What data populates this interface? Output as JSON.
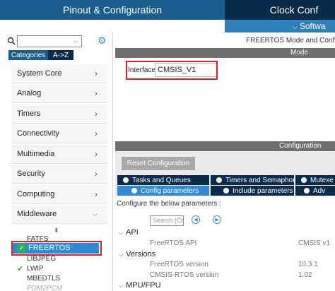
{
  "header": {
    "pinout_tab": "Pinout & Configuration",
    "clock_tab": "Clock Conf",
    "software_label": "Softwa"
  },
  "left": {
    "search_value": "",
    "categories_label": "Categories",
    "az_label": "A->Z",
    "categories": [
      "System Core",
      "Analog",
      "Timers",
      "Connectivity",
      "Multimedia",
      "Security",
      "Computing",
      "Middleware"
    ],
    "middleware_items": [
      "FATFS",
      "FREERTOS",
      "LIBJPEG",
      "LWIP",
      "MBEDTLS",
      "PDM2PCM"
    ]
  },
  "right": {
    "mode_title": "FREERTOS Mode and Configur",
    "mode_bar": "Mode",
    "interface_label": "Interface",
    "interface_value": "CMSIS_V1",
    "config_bar": "Configuration",
    "reset_button": "Reset Configuration",
    "tabs_row1": [
      "Tasks and Queues",
      "Timers and Semaphores",
      "Mutexe"
    ],
    "tabs_row2": [
      "Config parameters",
      "Include parameters",
      "Adv"
    ],
    "params_caption": "Configure the below parameters :",
    "search_placeholder": "Search (Ctrl+F)",
    "sections": {
      "api": "API",
      "versions": "Versions",
      "mpu": "MPU/FPU"
    },
    "params": [
      {
        "name": "FreeRTOS API",
        "value": "CMSIS v1"
      },
      {
        "name": "FreeRTOS version",
        "value": "10.3.1"
      },
      {
        "name": "CMSIS-RTOS version",
        "value": "1.02"
      }
    ]
  },
  "colors": {
    "header_blue": "#1b5d8e",
    "header_dark": "#0a2b4a",
    "accent_blue": "#2f89d4",
    "highlight_red": "#d91f26",
    "check_green": "#2bb24c"
  }
}
